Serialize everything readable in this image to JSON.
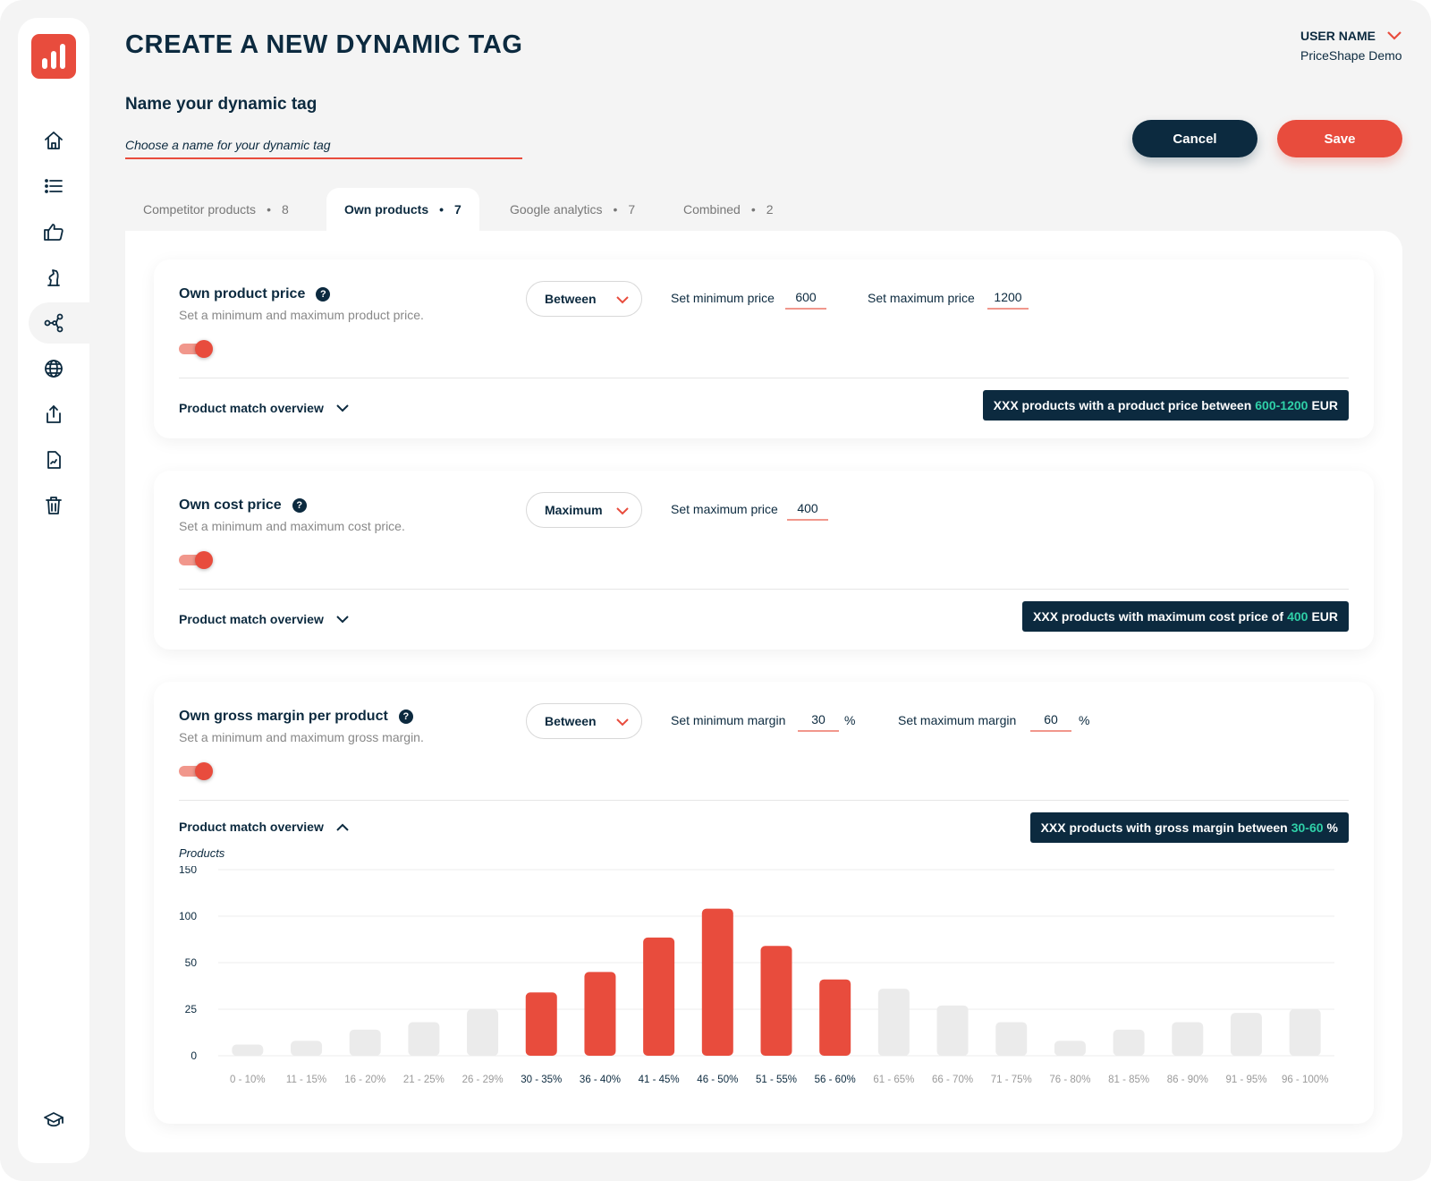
{
  "header": {
    "title": "CREATE A NEW DYNAMIC TAG",
    "user_name": "USER NAME",
    "company": "PriceShape Demo"
  },
  "name_section": {
    "label": "Name your dynamic tag",
    "placeholder": "Choose a name for your dynamic tag"
  },
  "actions": {
    "cancel": "Cancel",
    "save": "Save"
  },
  "tabs": [
    {
      "label": "Competitor products",
      "count": "8",
      "active": false
    },
    {
      "label": "Own products",
      "count": "7",
      "active": true
    },
    {
      "label": "Google analytics",
      "count": "7",
      "active": false
    },
    {
      "label": "Combined",
      "count": "2",
      "active": false
    }
  ],
  "cards": {
    "product_price": {
      "title": "Own product price",
      "description": "Set a minimum and maximum product price.",
      "mode": "Between",
      "min_label": "Set minimum price",
      "min_value": "600",
      "max_label": "Set maximum price",
      "max_value": "1200",
      "overview_label": "Product match overview",
      "summary_prefix": "XXX products with a product price between",
      "summary_value": "600-1200",
      "summary_suffix": "EUR"
    },
    "cost_price": {
      "title": "Own cost price",
      "description": "Set a minimum and maximum cost price.",
      "mode": "Maximum",
      "max_label": "Set maximum price",
      "max_value": "400",
      "overview_label": "Product match overview",
      "summary_prefix": "XXX products with maximum cost price of",
      "summary_value": "400",
      "summary_suffix": "EUR"
    },
    "gross_margin": {
      "title": "Own gross margin per product",
      "description": "Set a minimum and maximum gross margin.",
      "mode": "Between",
      "min_label": "Set minimum margin",
      "min_value": "30",
      "max_label": "Set maximum margin",
      "max_value": "60",
      "unit": "%",
      "overview_label": "Product match overview",
      "summary_prefix": "XXX products with gross margin between",
      "summary_value": "30-60",
      "summary_suffix": "%",
      "chart_ylabel": "Products"
    }
  },
  "colors": {
    "primary": "#0c2a3f",
    "accent": "#e84c3d",
    "highlight": "#2fd0a8",
    "bar_inactive": "#ebebeb"
  },
  "sidebar_icons": [
    "home-icon",
    "list-icon",
    "thumbs-up-icon",
    "chess-knight-icon",
    "share-nodes-icon",
    "globe-icon",
    "upload-icon",
    "document-chart-icon",
    "trash-icon",
    "graduation-cap-icon"
  ],
  "chart_data": {
    "type": "bar",
    "ylabel": "Products",
    "ytick_labels": [
      "0",
      "25",
      "50",
      "100",
      "150"
    ],
    "categories": [
      "0 - 10%",
      "11 - 15%",
      "16 - 20%",
      "21 - 25%",
      "26 - 29%",
      "30 - 35%",
      "36 - 40%",
      "41 - 45%",
      "46 - 50%",
      "51 - 55%",
      "56 - 60%",
      "61 - 65%",
      "66 - 70%",
      "71 - 75%",
      "76 - 80%",
      "81 - 85%",
      "86 - 90%",
      "91 - 95%",
      "96 - 100%"
    ],
    "values": [
      6,
      8,
      14,
      18,
      25,
      34,
      45,
      77,
      108,
      68,
      41,
      36,
      27,
      18,
      8,
      14,
      18,
      23,
      25
    ],
    "highlighted": [
      false,
      false,
      false,
      false,
      false,
      true,
      true,
      true,
      true,
      true,
      true,
      false,
      false,
      false,
      false,
      false,
      false,
      false,
      false
    ],
    "grid": true
  }
}
